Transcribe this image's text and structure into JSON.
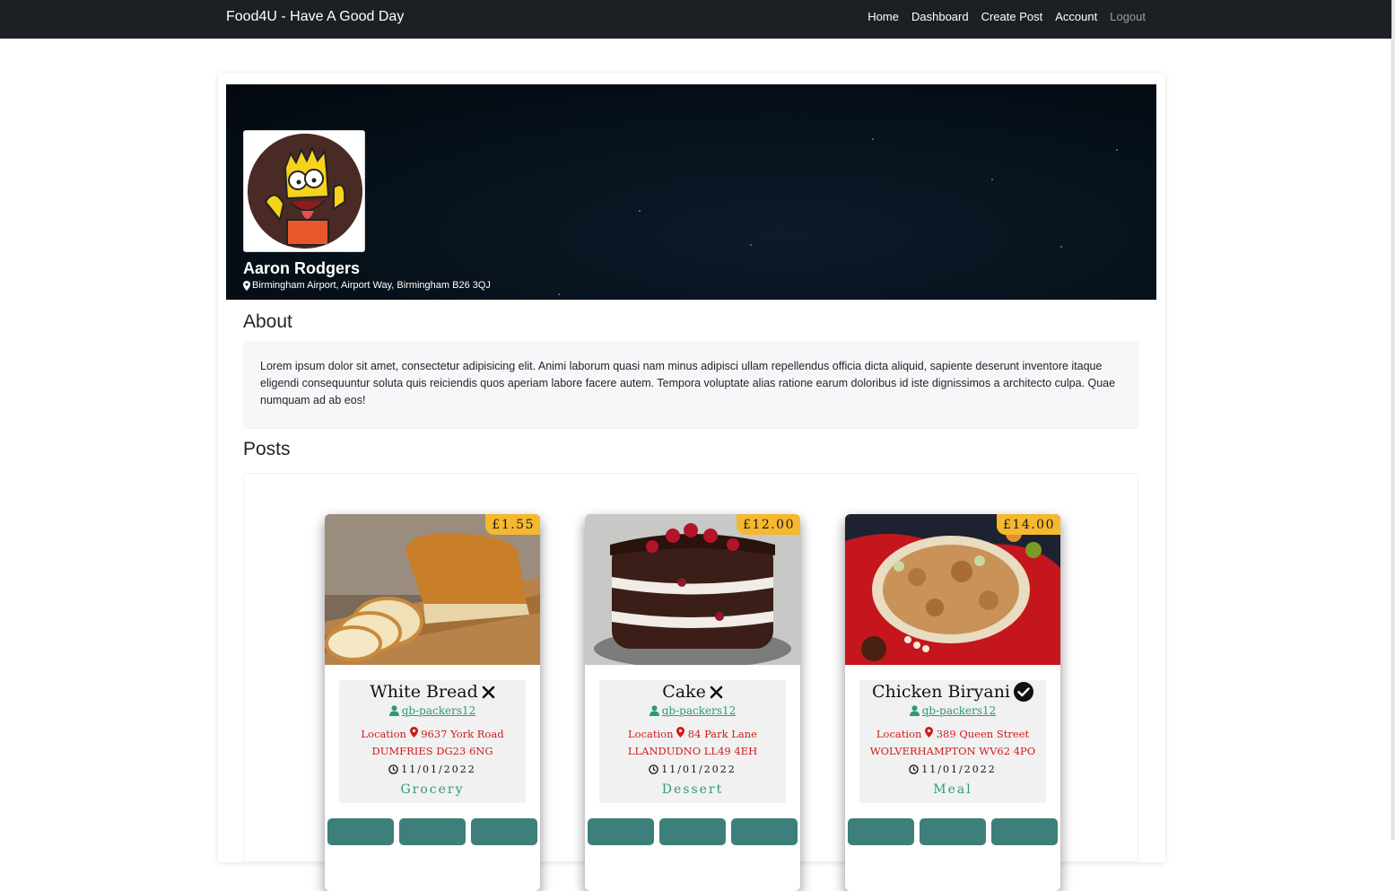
{
  "navbar": {
    "brand": "Food4U - Have A Good Day",
    "links": {
      "home": "Home",
      "dashboard": "Dashboard",
      "create_post": "Create Post",
      "account": "Account",
      "logout": "Logout"
    }
  },
  "profile": {
    "name": "Aaron Rodgers",
    "location": "Birmingham Airport, Airport Way, Birmingham B26 3QJ"
  },
  "about": {
    "heading": "About",
    "text": "Lorem ipsum dolor sit amet, consectetur adipisicing elit. Animi laborum quasi nam minus adipisci ullam repellendus officia dicta aliquid, sapiente deserunt inventore itaque eligendi consequuntur soluta quis reiciendis quos aperiam labore facere autem. Tempora voluptate alias ratione earum doloribus id iste dignissimos a architecto culpa. Quae numquam ad ab eos!"
  },
  "posts": {
    "heading": "Posts",
    "items": [
      {
        "price": "£1.55",
        "title": "White Bread",
        "status_icon": "close-icon",
        "owner": "qb-packers12",
        "location_label": "Location",
        "address_line1": "9637 York Road",
        "address_line2": "DUMFRIES DG23 6NG",
        "date": "11/01/2022",
        "category": "Grocery"
      },
      {
        "price": "£12.00",
        "title": "Cake",
        "status_icon": "close-icon",
        "owner": "qb-packers12",
        "location_label": "Location",
        "address_line1": "84 Park Lane",
        "address_line2": "LLANDUDNO LL49 4EH",
        "date": "11/01/2022",
        "category": "Dessert"
      },
      {
        "price": "£14.00",
        "title": "Chicken Biryani",
        "status_icon": "check-circle-icon",
        "owner": "qb-packers12",
        "location_label": "Location",
        "address_line1": "389 Queen Street",
        "address_line2": "WOLVERHAMPTON WV62 4PO",
        "date": "11/01/2022",
        "category": "Meal"
      }
    ]
  },
  "colors": {
    "navbar_bg": "#1c1f23",
    "price_badge": "#f5b82e",
    "owner_link": "#2b9c72",
    "location_text": "#d21a1a",
    "action_button": "#3d7f7a"
  }
}
